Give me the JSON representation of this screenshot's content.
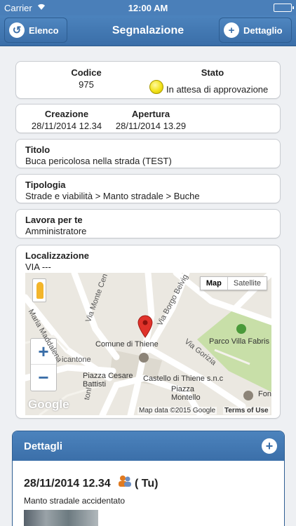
{
  "status_bar": {
    "carrier": "Carrier",
    "time": "12:00 AM"
  },
  "nav": {
    "back_label": "Elenco",
    "title": "Segnalazione",
    "detail_label": "Dettaglio"
  },
  "summary": {
    "codice_label": "Codice",
    "codice_value": "975",
    "stato_label": "Stato",
    "stato_value": "In attesa di approvazione",
    "stato_color": "#f2e21a"
  },
  "dates": {
    "creazione_label": "Creazione",
    "creazione_value": "28/11/2014 12.34",
    "apertura_label": "Apertura",
    "apertura_value": "28/11/2014 13.29"
  },
  "titolo": {
    "label": "Titolo",
    "value": "Buca pericolosa nella strada (TEST)"
  },
  "tipologia": {
    "label": "Tipologia",
    "value": "Strade e viabilità > Manto stradale > Buche"
  },
  "lavora": {
    "label": "Lavora per te",
    "value": "Amministratore"
  },
  "localizzazione": {
    "label": "Localizzazione",
    "value": "VIA ---",
    "map": {
      "toggle_map": "Map",
      "toggle_satellite": "Satellite",
      "zoom_in": "+",
      "zoom_out": "−",
      "labels": {
        "comune": "Comune di Thiene",
        "parco": "Parco Villa Fabris",
        "castello": "Castello di Thiene s.n.c",
        "piazza_montello": "Piazza\nMontello",
        "piazza_battisti": "Piazza Cesare\nBattisti",
        "fon": "Fon"
      },
      "streets": {
        "maddalena": "Maria Maddalena",
        "monte_cen": "Via Monte Cen",
        "borgo": "Via Borgo Belvig",
        "gorizia": "Via Gorizia",
        "vicantone": "icantone",
        "tonl": "tonl"
      },
      "google": "Google",
      "attribution": "Map data ©2015 Google",
      "terms": "Terms of Use"
    }
  },
  "dettagli": {
    "title": "Dettagli",
    "entry": {
      "date": "28/11/2014 12.34",
      "user": "( Tu)",
      "description": "Manto stradale accidentato"
    }
  }
}
